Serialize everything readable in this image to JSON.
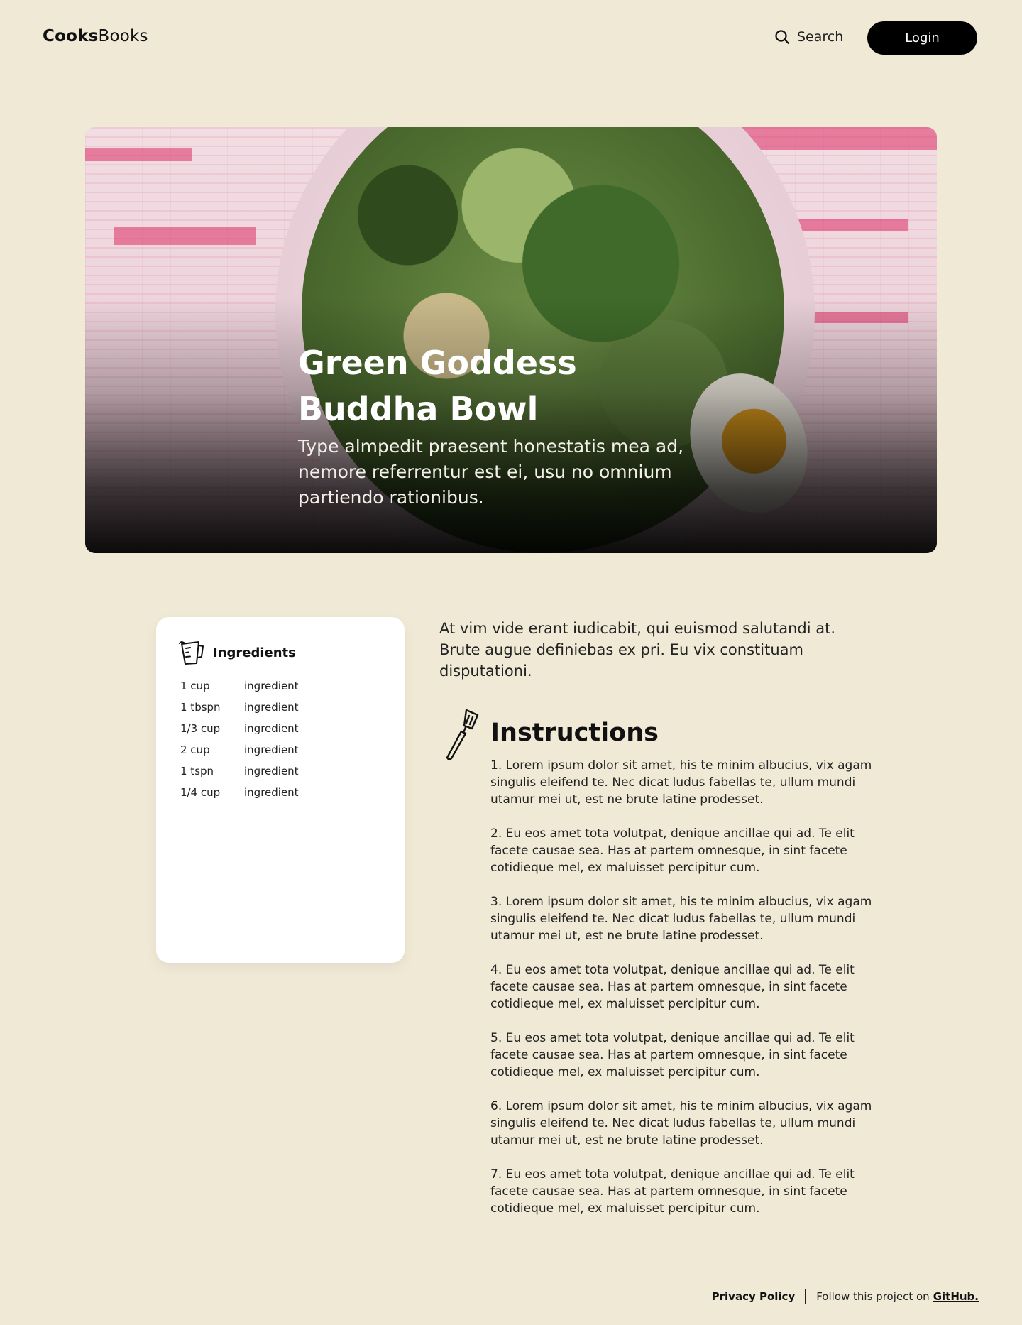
{
  "header": {
    "logo_bold": "Cooks",
    "logo_regular": "Books",
    "search_label": "Search",
    "login_label": "Login"
  },
  "hero": {
    "title": "Green Goddess Buddha Bowl",
    "subtitle": "Type almpedit praesent honestatis mea ad, nemore referrentur est ei, usu no omnium partiendo rationibus."
  },
  "ingredients": {
    "title": "Ingredients",
    "items": [
      {
        "qty": "1 cup",
        "name": "ingredient"
      },
      {
        "qty": "1 tbspn",
        "name": "ingredient"
      },
      {
        "qty": "1/3  cup",
        "name": "ingredient"
      },
      {
        "qty": "2  cup",
        "name": "ingredient"
      },
      {
        "qty": "1  tspn",
        "name": "ingredient"
      },
      {
        "qty": "1/4  cup",
        "name": "ingredient"
      }
    ]
  },
  "intro": "At vim vide erant iudicabit, qui euismod salutandi at. Brute augue definiebas ex pri. Eu vix constituam disputationi.",
  "instructions": {
    "title": "Instructions",
    "steps": [
      "1. Lorem ipsum dolor sit amet, his te minim albucius, vix agam singulis eleifend te. Nec dicat ludus fabellas te, ullum mundi utamur mei ut, est ne brute latine prodesset.",
      "2. Eu eos amet tota volutpat, denique ancillae qui ad. Te elit facete causae sea. Has at partem omnesque, in sint facete cotidieque mel, ex maluisset percipitur cum.",
      "3. Lorem ipsum dolor sit amet, his te minim albucius, vix agam singulis eleifend te. Nec dicat ludus fabellas te, ullum mundi utamur mei ut, est ne brute latine prodesset.",
      "4. Eu eos amet tota volutpat, denique ancillae qui ad. Te elit facete causae sea. Has at partem omnesque, in sint facete cotidieque mel, ex maluisset percipitur cum.",
      "5. Eu eos amet tota volutpat, denique ancillae qui ad. Te elit facete causae sea. Has at partem omnesque, in sint facete cotidieque mel, ex maluisset percipitur cum.",
      "6. Lorem ipsum dolor sit amet, his te minim albucius, vix agam singulis eleifend te. Nec dicat ludus fabellas te, ullum mundi utamur mei ut, est ne brute latine prodesset.",
      "7. Eu eos amet tota volutpat, denique ancillae qui ad. Te elit facete causae sea. Has at partem omnesque, in sint facete cotidieque mel, ex maluisset percipitur cum."
    ]
  },
  "footer": {
    "privacy_label": "Privacy Policy",
    "follow_text": "Follow this project on",
    "github_label": "GitHub."
  },
  "icons": {
    "search": "search-icon",
    "ingredients": "measuring-cup-icon",
    "instructions": "spatula-icon"
  },
  "colors": {
    "background": "#f0e9d6",
    "button": "#000000",
    "card": "#ffffff"
  }
}
